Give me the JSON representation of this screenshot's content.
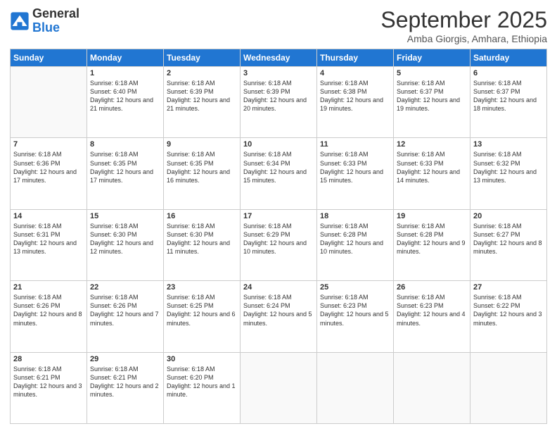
{
  "header": {
    "logo_line1": "General",
    "logo_line2": "Blue",
    "month": "September 2025",
    "location": "Amba Giorgis, Amhara, Ethiopia"
  },
  "weekdays": [
    "Sunday",
    "Monday",
    "Tuesday",
    "Wednesday",
    "Thursday",
    "Friday",
    "Saturday"
  ],
  "weeks": [
    [
      null,
      {
        "day": "1",
        "sunrise": "6:18 AM",
        "sunset": "6:40 PM",
        "daylight": "12 hours and 21 minutes."
      },
      {
        "day": "2",
        "sunrise": "6:18 AM",
        "sunset": "6:39 PM",
        "daylight": "12 hours and 21 minutes."
      },
      {
        "day": "3",
        "sunrise": "6:18 AM",
        "sunset": "6:39 PM",
        "daylight": "12 hours and 20 minutes."
      },
      {
        "day": "4",
        "sunrise": "6:18 AM",
        "sunset": "6:38 PM",
        "daylight": "12 hours and 19 minutes."
      },
      {
        "day": "5",
        "sunrise": "6:18 AM",
        "sunset": "6:37 PM",
        "daylight": "12 hours and 19 minutes."
      },
      {
        "day": "6",
        "sunrise": "6:18 AM",
        "sunset": "6:37 PM",
        "daylight": "12 hours and 18 minutes."
      }
    ],
    [
      {
        "day": "7",
        "sunrise": "6:18 AM",
        "sunset": "6:36 PM",
        "daylight": "12 hours and 17 minutes."
      },
      {
        "day": "8",
        "sunrise": "6:18 AM",
        "sunset": "6:35 PM",
        "daylight": "12 hours and 17 minutes."
      },
      {
        "day": "9",
        "sunrise": "6:18 AM",
        "sunset": "6:35 PM",
        "daylight": "12 hours and 16 minutes."
      },
      {
        "day": "10",
        "sunrise": "6:18 AM",
        "sunset": "6:34 PM",
        "daylight": "12 hours and 15 minutes."
      },
      {
        "day": "11",
        "sunrise": "6:18 AM",
        "sunset": "6:33 PM",
        "daylight": "12 hours and 15 minutes."
      },
      {
        "day": "12",
        "sunrise": "6:18 AM",
        "sunset": "6:33 PM",
        "daylight": "12 hours and 14 minutes."
      },
      {
        "day": "13",
        "sunrise": "6:18 AM",
        "sunset": "6:32 PM",
        "daylight": "12 hours and 13 minutes."
      }
    ],
    [
      {
        "day": "14",
        "sunrise": "6:18 AM",
        "sunset": "6:31 PM",
        "daylight": "12 hours and 13 minutes."
      },
      {
        "day": "15",
        "sunrise": "6:18 AM",
        "sunset": "6:30 PM",
        "daylight": "12 hours and 12 minutes."
      },
      {
        "day": "16",
        "sunrise": "6:18 AM",
        "sunset": "6:30 PM",
        "daylight": "12 hours and 11 minutes."
      },
      {
        "day": "17",
        "sunrise": "6:18 AM",
        "sunset": "6:29 PM",
        "daylight": "12 hours and 10 minutes."
      },
      {
        "day": "18",
        "sunrise": "6:18 AM",
        "sunset": "6:28 PM",
        "daylight": "12 hours and 10 minutes."
      },
      {
        "day": "19",
        "sunrise": "6:18 AM",
        "sunset": "6:28 PM",
        "daylight": "12 hours and 9 minutes."
      },
      {
        "day": "20",
        "sunrise": "6:18 AM",
        "sunset": "6:27 PM",
        "daylight": "12 hours and 8 minutes."
      }
    ],
    [
      {
        "day": "21",
        "sunrise": "6:18 AM",
        "sunset": "6:26 PM",
        "daylight": "12 hours and 8 minutes."
      },
      {
        "day": "22",
        "sunrise": "6:18 AM",
        "sunset": "6:26 PM",
        "daylight": "12 hours and 7 minutes."
      },
      {
        "day": "23",
        "sunrise": "6:18 AM",
        "sunset": "6:25 PM",
        "daylight": "12 hours and 6 minutes."
      },
      {
        "day": "24",
        "sunrise": "6:18 AM",
        "sunset": "6:24 PM",
        "daylight": "12 hours and 5 minutes."
      },
      {
        "day": "25",
        "sunrise": "6:18 AM",
        "sunset": "6:23 PM",
        "daylight": "12 hours and 5 minutes."
      },
      {
        "day": "26",
        "sunrise": "6:18 AM",
        "sunset": "6:23 PM",
        "daylight": "12 hours and 4 minutes."
      },
      {
        "day": "27",
        "sunrise": "6:18 AM",
        "sunset": "6:22 PM",
        "daylight": "12 hours and 3 minutes."
      }
    ],
    [
      {
        "day": "28",
        "sunrise": "6:18 AM",
        "sunset": "6:21 PM",
        "daylight": "12 hours and 3 minutes."
      },
      {
        "day": "29",
        "sunrise": "6:18 AM",
        "sunset": "6:21 PM",
        "daylight": "12 hours and 2 minutes."
      },
      {
        "day": "30",
        "sunrise": "6:18 AM",
        "sunset": "6:20 PM",
        "daylight": "12 hours and 1 minute."
      },
      null,
      null,
      null,
      null
    ]
  ]
}
